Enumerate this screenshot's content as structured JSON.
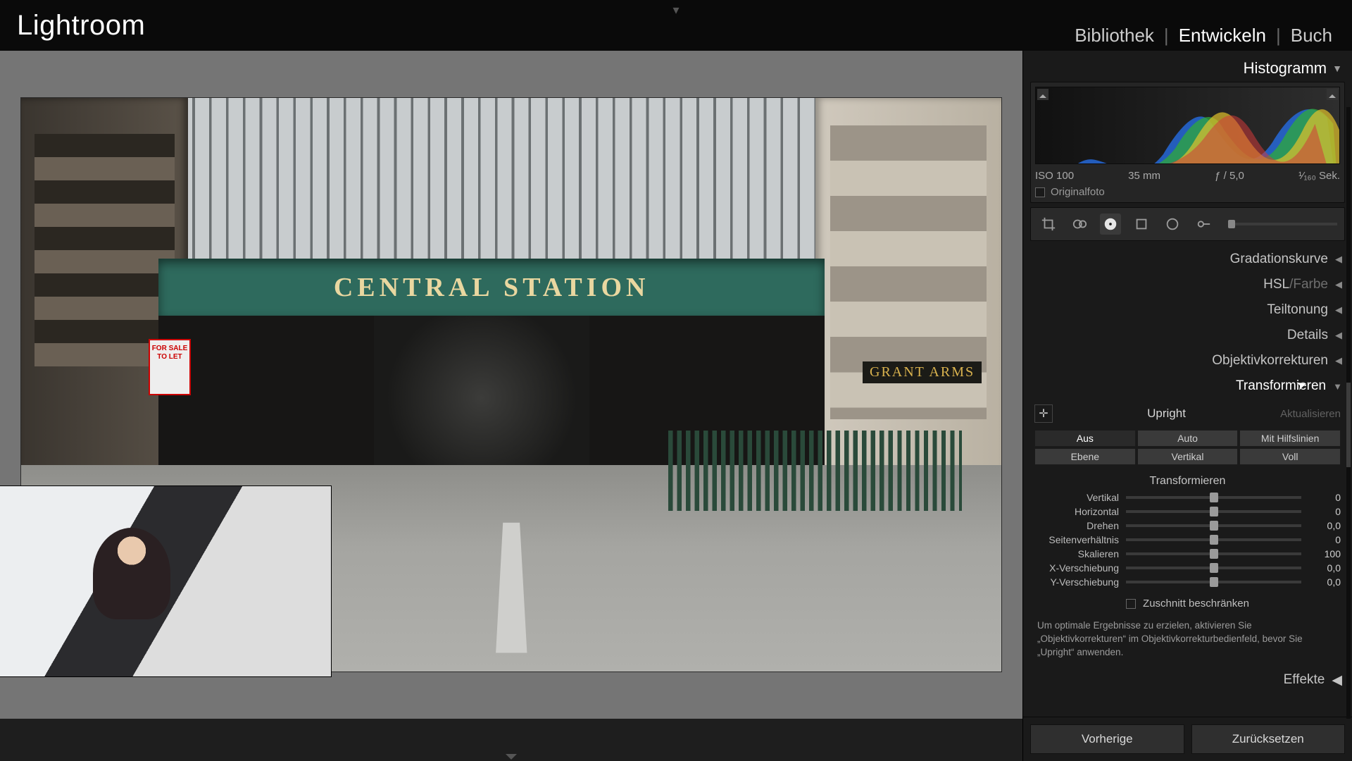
{
  "app": {
    "title": "Lightroom"
  },
  "modules": {
    "library": "Bibliothek",
    "develop": "Entwickeln",
    "book": "Buch",
    "active": "develop"
  },
  "photo_scene": {
    "marquee_text": "CENTRAL STATION",
    "pub_sign": "GRANT ARMS",
    "for_sale": "FOR SALE\nTO LET"
  },
  "panels": {
    "histogram": {
      "title": "Histogramm",
      "iso": "ISO 100",
      "focal": "35 mm",
      "aperture": "ƒ / 5,0",
      "shutter": "¹⁄₁₆₀ Sek.",
      "original_label": "Originalfoto",
      "original_checked": false
    },
    "tone_curve": "Gradationskurve",
    "hsl_label_a": "HSL",
    "hsl_label_b": "Farbe",
    "split_toning": "Teiltonung",
    "details": "Details",
    "lens_corr": "Objektivkorrekturen",
    "transform": {
      "title": "Transformieren",
      "upright_label": "Upright",
      "refresh_label": "Aktualisieren",
      "modes": {
        "off": "Aus",
        "auto": "Auto",
        "guided": "Mit Hilfslinien",
        "level": "Ebene",
        "vertical": "Vertikal",
        "full": "Voll"
      },
      "section_label": "Transformieren",
      "sliders": [
        {
          "label": "Vertikal",
          "value": "0",
          "pos": 50
        },
        {
          "label": "Horizontal",
          "value": "0",
          "pos": 50
        },
        {
          "label": "Drehen",
          "value": "0,0",
          "pos": 50
        },
        {
          "label": "Seitenverhältnis",
          "value": "0",
          "pos": 50
        },
        {
          "label": "Skalieren",
          "value": "100",
          "pos": 50
        },
        {
          "label": "X-Verschiebung",
          "value": "0,0",
          "pos": 50
        },
        {
          "label": "Y-Verschiebung",
          "value": "0,0",
          "pos": 50
        }
      ],
      "constrain_crop": "Zuschnitt beschränken",
      "hint": "Um optimale Ergebnisse zu erzielen, aktivieren Sie „Objektivkorrekturen“ im Objektivkorrekturbedienfeld, bevor Sie „Upright“ anwenden."
    },
    "effects": "Effekte"
  },
  "footer": {
    "previous": "Vorherige",
    "reset": "Zurücksetzen"
  }
}
